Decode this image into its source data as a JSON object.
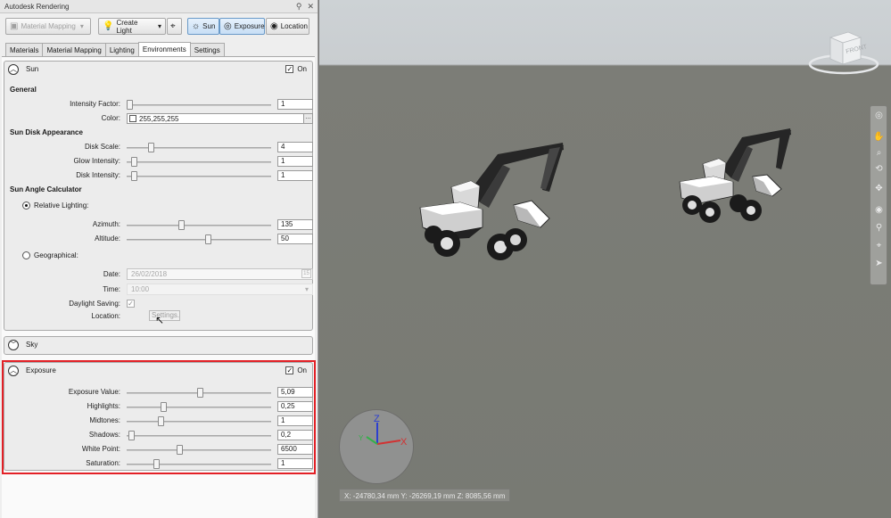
{
  "window": {
    "title": "Autodesk Rendering"
  },
  "toolbar": {
    "material_mapping": "Material Mapping",
    "create_light": "Create Light",
    "sun": "Sun",
    "exposure": "Exposure",
    "location": "Location"
  },
  "tabs": [
    "Materials",
    "Material Mapping",
    "Lighting",
    "Environments",
    "Settings"
  ],
  "selected_tab": "Environments",
  "sun": {
    "title": "Sun",
    "on_label": "On",
    "on": true,
    "general_title": "General",
    "intensity_label": "Intensity Factor:",
    "intensity_value": "1",
    "color_label": "Color:",
    "color_value": "255,255,255",
    "disk_title": "Sun Disk Appearance",
    "disk_scale_label": "Disk Scale:",
    "disk_scale_value": "4",
    "glow_label": "Glow Intensity:",
    "glow_value": "1",
    "disk_intensity_label": "Disk Intensity:",
    "disk_intensity_value": "1",
    "angle_title": "Sun Angle Calculator",
    "relative_label": "Relative Lighting:",
    "azimuth_label": "Azimuth:",
    "azimuth_value": "135",
    "altitude_label": "Altitude:",
    "altitude_value": "50",
    "geo_label": "Geographical:",
    "date_label": "Date:",
    "date_value": "26/02/2018",
    "time_label": "Time:",
    "time_value": "10:00",
    "daylight_label": "Daylight Saving:",
    "location_label": "Location:",
    "settings_button": "Settings..."
  },
  "sky": {
    "title": "Sky"
  },
  "exposure": {
    "title": "Exposure",
    "on_label": "On",
    "on": true,
    "ev_label": "Exposure Value:",
    "ev_value": "5,09",
    "highlights_label": "Highlights:",
    "highlights_value": "0,25",
    "midtones_label": "Midtones:",
    "midtones_value": "1",
    "shadows_label": "Shadows:",
    "shadows_value": "0,2",
    "white_label": "White Point:",
    "white_value": "6500",
    "saturation_label": "Saturation:",
    "saturation_value": "1"
  },
  "viewport": {
    "coords": "X: -24780,34 mm  Y: -26269,19 mm  Z: 8085,56 mm",
    "viewcube_face": "FRONT",
    "axis_x": "X",
    "axis_y": "Y",
    "axis_z": "Z"
  },
  "colors": {
    "highlight": "#e32026",
    "accent": "#4a86c5"
  }
}
